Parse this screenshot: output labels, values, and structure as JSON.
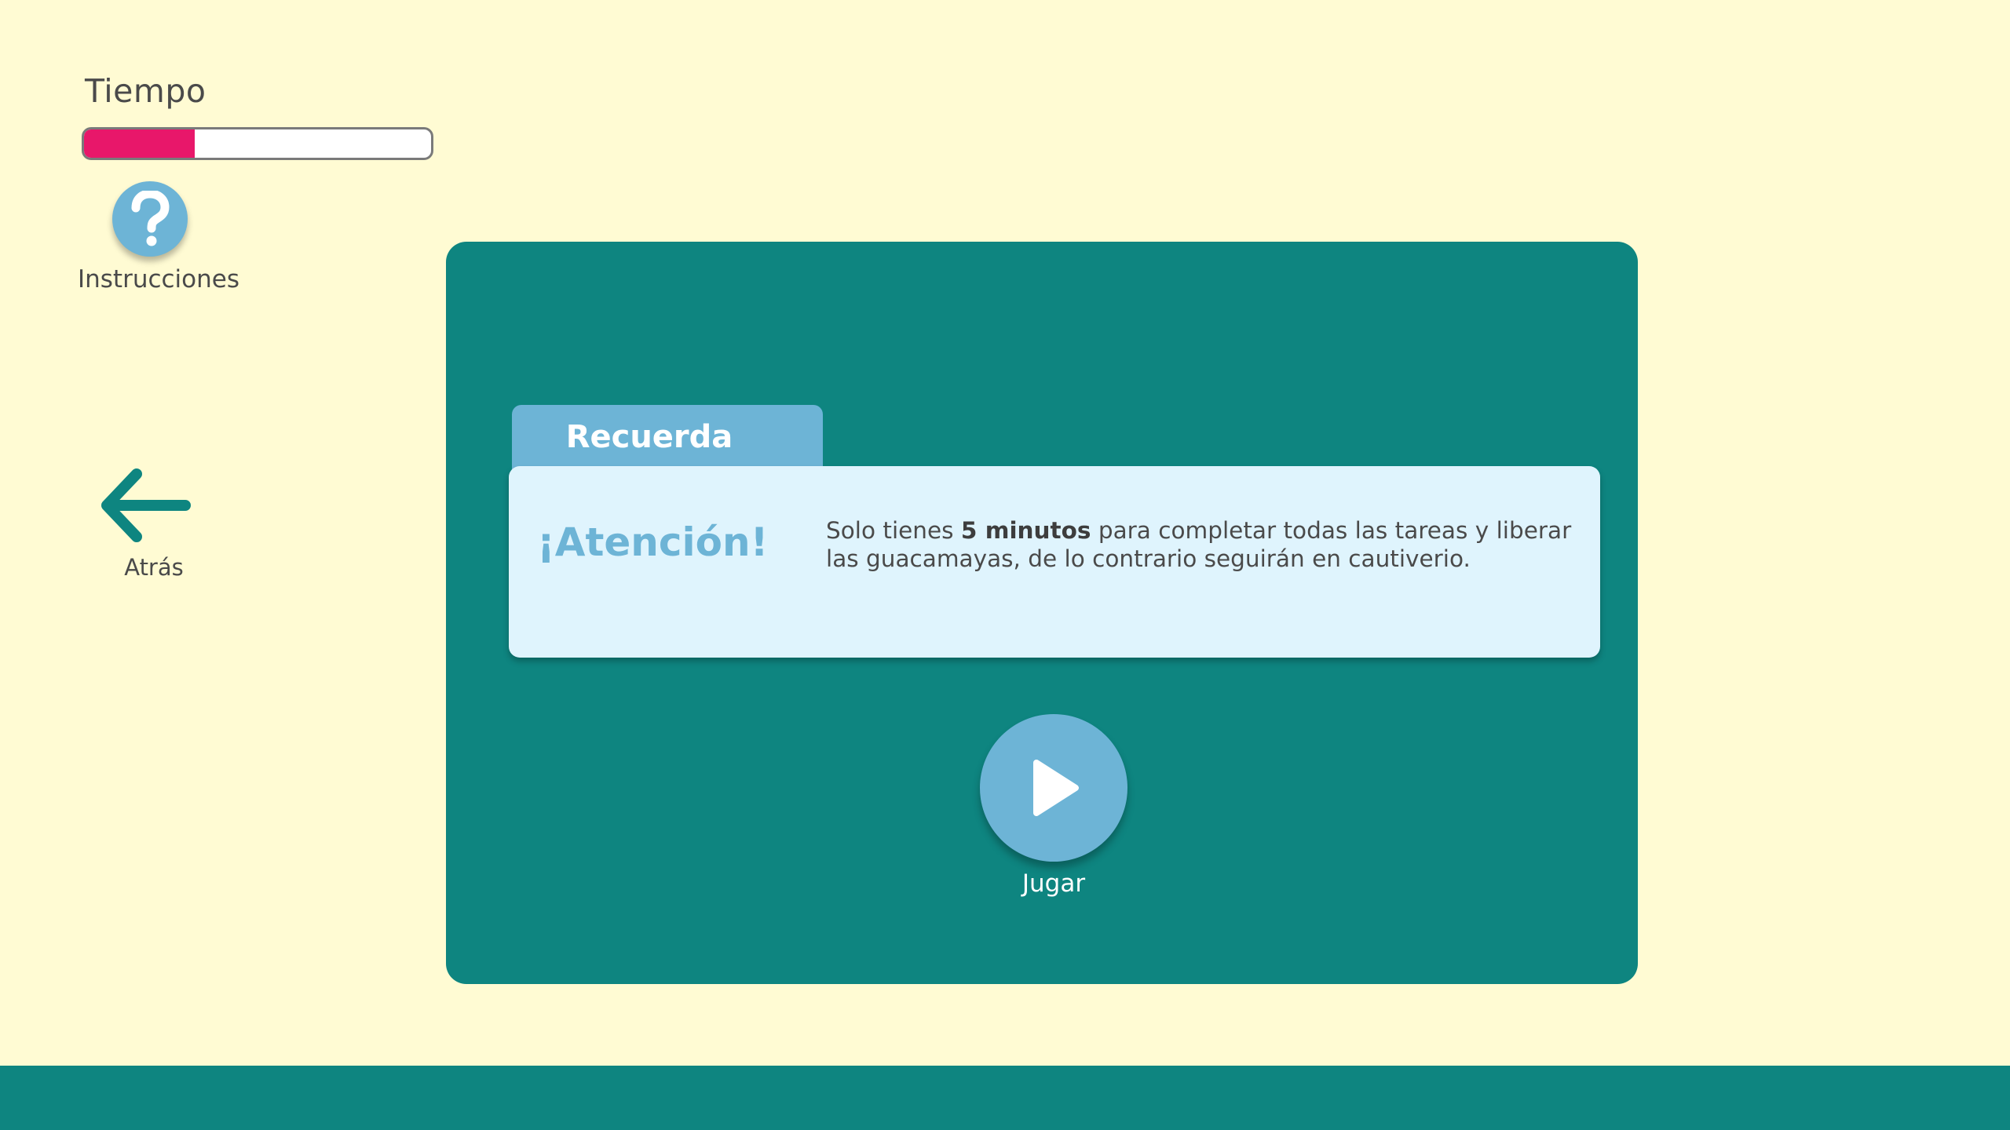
{
  "timer": {
    "label": "Tiempo",
    "progress_fraction": 0.32,
    "fill_color": "#e8176a"
  },
  "instructions": {
    "label": "Instrucciones",
    "icon": "question-icon"
  },
  "back": {
    "label": "Atrás",
    "icon": "arrow-left-icon"
  },
  "panel": {
    "tab_label": "Recuerda",
    "card_title": "¡Atención!",
    "message_prefix": "Solo tienes ",
    "message_bold": "5 minutos",
    "message_suffix": " para completar todas las tareas y liberar las guacamayas, de lo contrario seguirán en cautiverio."
  },
  "play": {
    "label": "Jugar",
    "icon": "play-icon"
  },
  "colors": {
    "background": "#fffbd3",
    "teal": "#0e8580",
    "accent_blue": "#6db4d6",
    "card_bg": "#dff4fd",
    "timer_fill": "#e8176a"
  }
}
